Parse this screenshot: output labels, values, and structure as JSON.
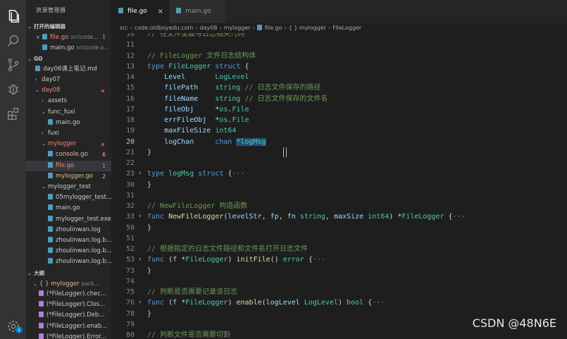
{
  "activity": {
    "icons": [
      "explorer-icon",
      "search-icon",
      "source-control-icon",
      "debug-icon",
      "extensions-icon",
      "settings-icon"
    ],
    "settings_badge": "1"
  },
  "sidebar": {
    "title": "资源管理器",
    "open_editors_label": "打开的编辑器",
    "open_editors": [
      {
        "name": "file.go",
        "path": "src\\code...",
        "badge": "1"
      },
      {
        "name": "main.go",
        "path": "src\\code.o..."
      }
    ],
    "workspace_label": "GO",
    "tree": [
      {
        "label": "day06课上笔记.md",
        "indent": 1
      },
      {
        "label": "day07",
        "indent": 1,
        "chev": "›"
      },
      {
        "label": "day08",
        "indent": 1,
        "chev": "⌄",
        "dot": true
      },
      {
        "label": "assets",
        "indent": 2,
        "chev": "›"
      },
      {
        "label": "func_fuxi",
        "indent": 2,
        "chev": "⌄"
      },
      {
        "label": "main.go",
        "indent": 3
      },
      {
        "label": "fuxi",
        "indent": 2,
        "chev": "›"
      },
      {
        "label": "mylogger",
        "indent": 2,
        "chev": "⌄",
        "dot": true
      },
      {
        "label": "console.go",
        "indent": 3,
        "badge": "6"
      },
      {
        "label": "file.go",
        "indent": 3,
        "badge": "1",
        "active": true
      },
      {
        "label": "mylogger.go",
        "indent": 3,
        "badge": "2"
      },
      {
        "label": "mylogger_test",
        "indent": 2,
        "chev": "⌄"
      },
      {
        "label": "05mylogger_test....",
        "indent": 3
      },
      {
        "label": "main.go",
        "indent": 3
      },
      {
        "label": "mylogger_test.exe",
        "indent": 3
      },
      {
        "label": "zhoulinwan.log",
        "indent": 3
      },
      {
        "label": "zhoulinwan.log.b...",
        "indent": 3
      },
      {
        "label": "zhoulinwan.log.b...",
        "indent": 3
      },
      {
        "label": "zhoulinwan.log.b...",
        "indent": 3
      }
    ],
    "outline_label": "大纲",
    "outline": [
      {
        "label": "{ } mylogger",
        "sub": "pack...",
        "indent": 1
      },
      {
        "label": "(*FileLogger).chec...",
        "indent": 2
      },
      {
        "label": "(*FileLogger).Clos...",
        "indent": 2
      },
      {
        "label": "(*FileLogger).Deb...",
        "indent": 2
      },
      {
        "label": "(*FileLogger).enab...",
        "indent": 2
      },
      {
        "label": "(*FileLogger).Error...",
        "indent": 2
      }
    ]
  },
  "tabs": [
    {
      "label": "file.go",
      "close": "×"
    },
    {
      "label": "main.go"
    }
  ],
  "breadcrumb": [
    "src",
    "code.oldboyedu.com",
    "day08",
    "mylogger",
    "file.go",
    "{ } mylogger",
    "FileLogger"
  ],
  "editor": {
    "lines": [
      {
        "n": "10",
        "tokens": [
          [
            "c-com",
            "// 往文件里面写日志相关代码"
          ]
        ]
      },
      {
        "n": "11",
        "tokens": []
      },
      {
        "n": "12",
        "tokens": [
          [
            "c-com",
            "// FileLogger 文件日志结构体"
          ]
        ]
      },
      {
        "n": "13",
        "tokens": [
          [
            "c-kw",
            "type "
          ],
          [
            "c-type",
            "FileLogger "
          ],
          [
            "c-kw",
            "struct "
          ],
          [
            "c-p",
            "{"
          ]
        ]
      },
      {
        "n": "14",
        "tokens": [
          [
            "c-id",
            "    Level       "
          ],
          [
            "c-type",
            "LogLevel"
          ]
        ]
      },
      {
        "n": "15",
        "tokens": [
          [
            "c-id",
            "    filePath    "
          ],
          [
            "c-type",
            "string "
          ],
          [
            "c-com",
            "// 日志文件保存的路径"
          ]
        ]
      },
      {
        "n": "16",
        "tokens": [
          [
            "c-id",
            "    fileName    "
          ],
          [
            "c-type",
            "string "
          ],
          [
            "c-com",
            "// 日志文件保存的文件名"
          ]
        ]
      },
      {
        "n": "17",
        "tokens": [
          [
            "c-id",
            "    fileObj     "
          ],
          [
            "c-p",
            "*"
          ],
          [
            "c-type",
            "os"
          ],
          [
            "c-p",
            "."
          ],
          [
            "c-type",
            "File"
          ]
        ]
      },
      {
        "n": "18",
        "tokens": [
          [
            "c-id",
            "    errFileObj  "
          ],
          [
            "c-p",
            "*"
          ],
          [
            "c-type",
            "os"
          ],
          [
            "c-p",
            "."
          ],
          [
            "c-type",
            "File"
          ]
        ]
      },
      {
        "n": "19",
        "tokens": [
          [
            "c-id",
            "    maxFileSize "
          ],
          [
            "c-type",
            "int64"
          ]
        ]
      },
      {
        "n": "20",
        "cur": true,
        "tokens": [
          [
            "c-id",
            "    logChan     "
          ],
          [
            "c-kw",
            "chan "
          ],
          [
            "c-type sel",
            "*logMsg"
          ]
        ]
      },
      {
        "n": "21",
        "tokens": [
          [
            "c-p",
            "}"
          ]
        ]
      },
      {
        "n": "22",
        "tokens": []
      },
      {
        "n": "23",
        "fold": "›",
        "tokens": [
          [
            "c-kw",
            "type "
          ],
          [
            "c-type",
            "logMsg "
          ],
          [
            "c-kw",
            "struct "
          ],
          [
            "c-p",
            "{"
          ],
          [
            "ellipsis",
            "···"
          ]
        ]
      },
      {
        "n": "30",
        "tokens": [
          [
            "c-p",
            "}"
          ]
        ]
      },
      {
        "n": "31",
        "tokens": []
      },
      {
        "n": "32",
        "tokens": [
          [
            "c-com",
            "// NewFileLogger 构造函数"
          ]
        ]
      },
      {
        "n": "33",
        "fold": "›",
        "tokens": [
          [
            "c-kw",
            "func "
          ],
          [
            "c-fn",
            "NewFileLogger"
          ],
          [
            "c-p",
            "("
          ],
          [
            "c-id",
            "levelStr"
          ],
          [
            "c-p",
            ", "
          ],
          [
            "c-id",
            "fp"
          ],
          [
            "c-p",
            ", "
          ],
          [
            "c-id",
            "fn "
          ],
          [
            "c-type",
            "string"
          ],
          [
            "c-p",
            ", "
          ],
          [
            "c-id",
            "maxSize "
          ],
          [
            "c-type",
            "int64"
          ],
          [
            "c-p",
            ") *"
          ],
          [
            "c-type",
            "FileLogger "
          ],
          [
            "c-p",
            "{"
          ],
          [
            "ellipsis",
            "···"
          ]
        ]
      },
      {
        "n": "50",
        "tokens": [
          [
            "c-p",
            "}"
          ]
        ]
      },
      {
        "n": "51",
        "tokens": []
      },
      {
        "n": "52",
        "tokens": [
          [
            "c-com",
            "// 根据指定的日志文件路径和文件名打开日志文件"
          ]
        ]
      },
      {
        "n": "53",
        "fold": "›",
        "tokens": [
          [
            "c-kw",
            "func "
          ],
          [
            "c-p",
            "("
          ],
          [
            "c-id",
            "f "
          ],
          [
            "c-p",
            "*"
          ],
          [
            "c-type",
            "FileLogger"
          ],
          [
            "c-p",
            ") "
          ],
          [
            "c-fn",
            "initFile"
          ],
          [
            "c-p",
            "() "
          ],
          [
            "c-type",
            "error "
          ],
          [
            "c-p",
            "{"
          ],
          [
            "ellipsis",
            "···"
          ]
        ]
      },
      {
        "n": "73",
        "tokens": [
          [
            "c-p",
            "}"
          ]
        ]
      },
      {
        "n": "74",
        "tokens": []
      },
      {
        "n": "75",
        "tokens": [
          [
            "c-com",
            "// 判断是否需要记录该日志"
          ]
        ]
      },
      {
        "n": "76",
        "fold": "›",
        "tokens": [
          [
            "c-kw",
            "func "
          ],
          [
            "c-p",
            "("
          ],
          [
            "c-id",
            "f "
          ],
          [
            "c-p",
            "*"
          ],
          [
            "c-type",
            "FileLogger"
          ],
          [
            "c-p",
            ") "
          ],
          [
            "c-fn",
            "enable"
          ],
          [
            "c-p",
            "("
          ],
          [
            "c-id",
            "logLevel "
          ],
          [
            "c-type",
            "LogLevel"
          ],
          [
            "c-p",
            ") "
          ],
          [
            "c-type",
            "bool "
          ],
          [
            "c-p",
            "{"
          ],
          [
            "ellipsis",
            "···"
          ]
        ]
      },
      {
        "n": "78",
        "tokens": [
          [
            "c-p",
            "}"
          ]
        ]
      },
      {
        "n": "79",
        "tokens": []
      },
      {
        "n": "80",
        "tokens": [
          [
            "c-com",
            "// 判断文件是否需要切割"
          ]
        ]
      }
    ]
  },
  "watermark": "CSDN @48N6E"
}
